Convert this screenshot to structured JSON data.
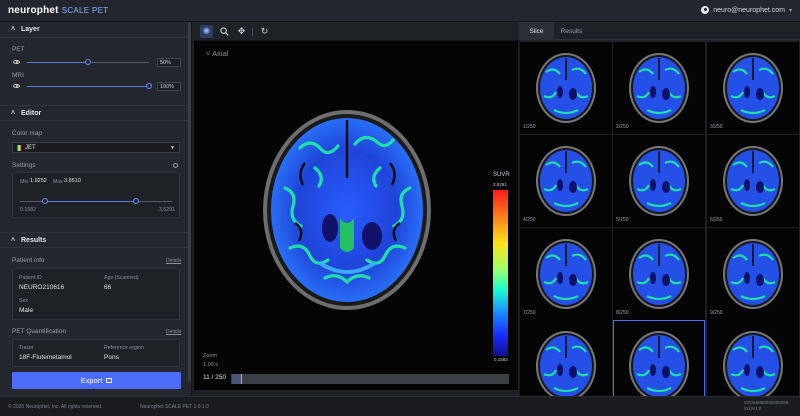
{
  "header": {
    "brand_name": "neurophet",
    "product": "SCALE PET",
    "user_email": "neuro@neurophet.com"
  },
  "left": {
    "layer": {
      "title": "Layer",
      "pet_label": "PET",
      "pet_value": "50%",
      "pet_level": 0.5,
      "mri_label": "MRI",
      "mri_value": "100%",
      "mri_level": 1.0
    },
    "editor": {
      "title": "Editor",
      "colormap_label": "Color map",
      "colormap_value": "JET",
      "settings_label": "Settings",
      "min_label": "Min",
      "min_value": "1.9252",
      "max_label": "Max",
      "max_value": "3.8510",
      "range_low": "0.1582",
      "range_high": "3.5291"
    },
    "results": {
      "title": "Results",
      "patient_info_label": "Patient info",
      "details_label": "Details",
      "patient_id_label": "Patient ID",
      "patient_id_value": "NEURO210616",
      "age_label": "Age (Scanned)",
      "age_value": "66",
      "sex_label": "Sex",
      "sex_value": "Male",
      "pet_quant_label": "PET Quantification",
      "details2_label": "Details",
      "tracer_label": "Tracer",
      "tracer_value": "18F-Flutemetamol",
      "ref_region_label": "Reference region",
      "ref_region_value": "Pons"
    },
    "export_label": "Export"
  },
  "viewer": {
    "view_label": "Axial",
    "suvr_title": "SUVR",
    "cbar_max": "3.5291",
    "cbar_min": "0.1582",
    "zoom_label": "Zoom",
    "zoom_value": "1.00 x",
    "slice_indicator": "11 / 250",
    "slice_fraction": 0.044
  },
  "right": {
    "tabs": [
      "Slice",
      "Results"
    ],
    "thumbnails": [
      "1/250",
      "2/250",
      "3/250",
      "4/250",
      "5/250",
      "6/250",
      "7/250",
      "8/250",
      "9/250",
      "10/250",
      "11/250",
      "12/250"
    ]
  },
  "footer": {
    "copyright": "© 2020 Neurophet, Inc. All rights reserved.",
    "version": "Neurophet SCALE PET 1.0.1.0",
    "code_line1": "CE0S6860030400098",
    "code_line2": "(01)V1.0"
  }
}
